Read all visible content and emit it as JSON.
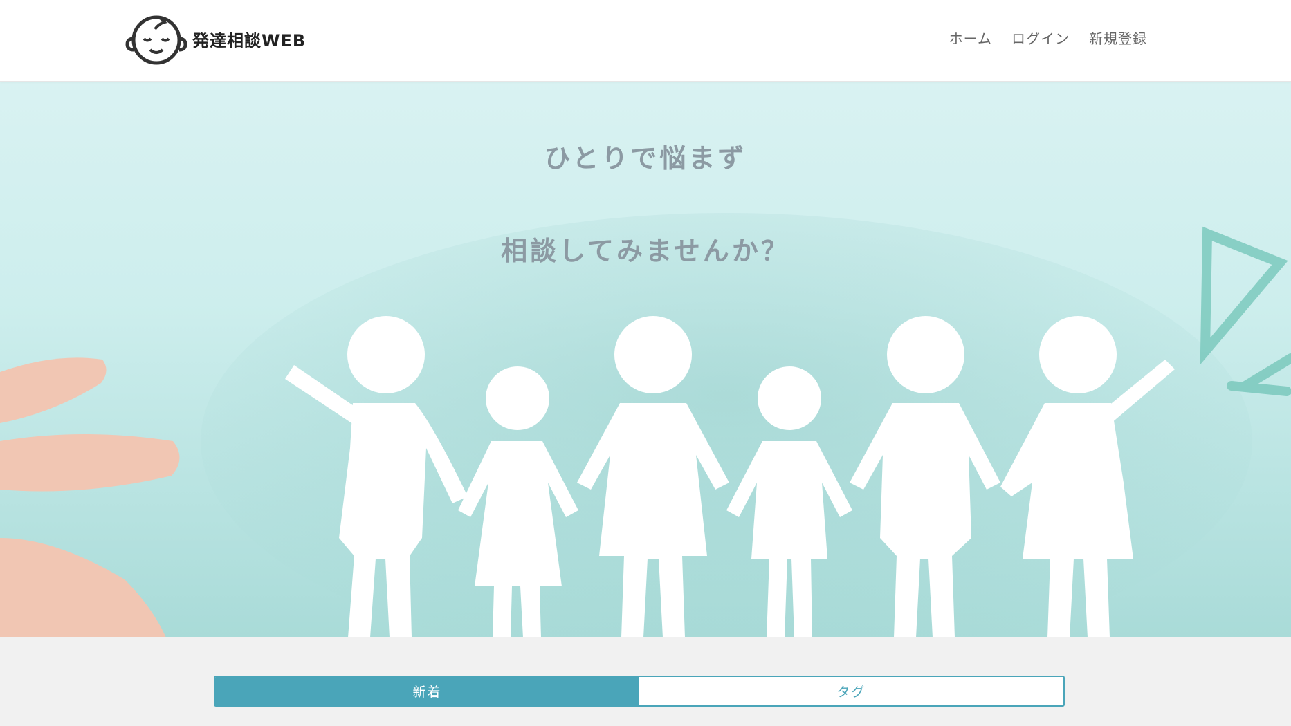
{
  "header": {
    "logo_text": "発達相談WEB",
    "nav": {
      "home": "ホーム",
      "login": "ログイン",
      "register": "新規登録"
    }
  },
  "hero": {
    "line1": "ひとりで悩まず",
    "line2": "相談してみませんか？"
  },
  "tabs": {
    "new_label": "新着",
    "tag_label": "タグ"
  },
  "colors": {
    "accent": "#4aa5b9",
    "hero_bg": "#cdeeed",
    "hero_text": "#8c9aa3"
  }
}
